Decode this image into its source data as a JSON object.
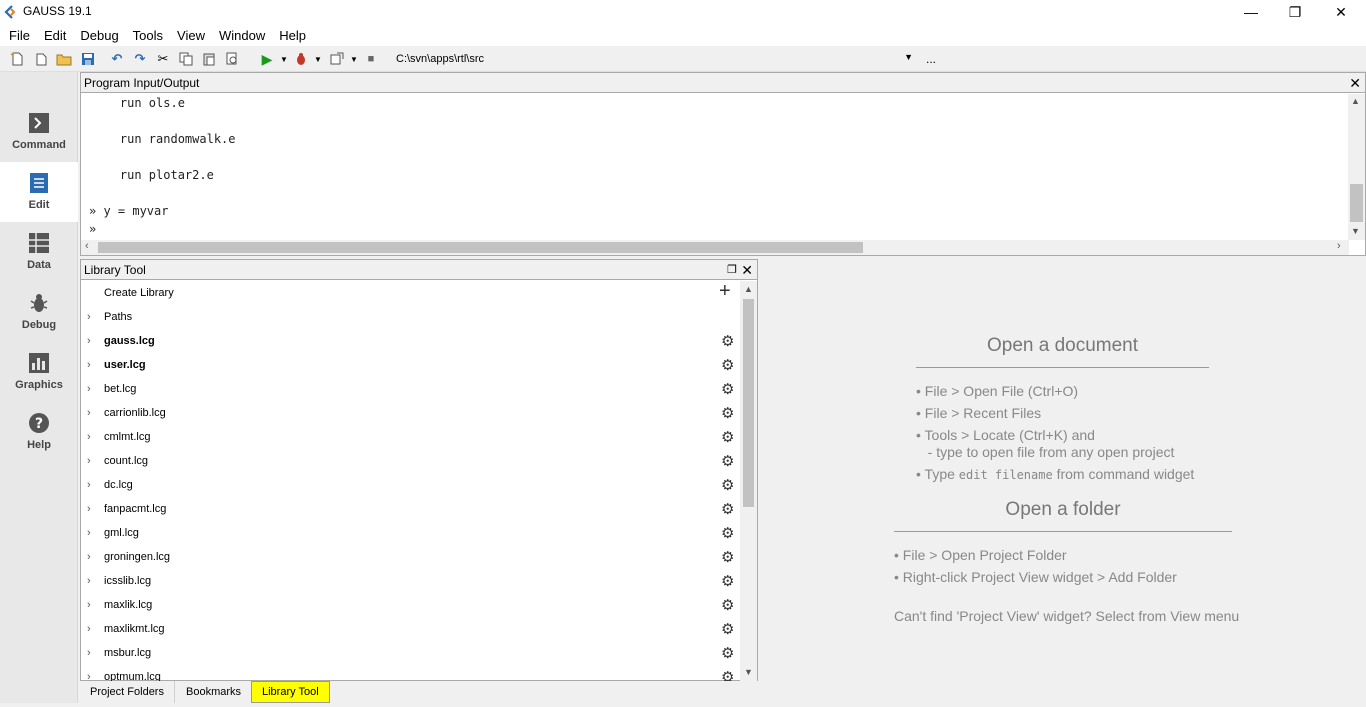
{
  "window": {
    "title": "GAUSS 19.1",
    "minimize": "—",
    "maximize": "❐",
    "close": "✕"
  },
  "menu": [
    "File",
    "Edit",
    "Debug",
    "Tools",
    "View",
    "Window",
    "Help"
  ],
  "toolbar": {
    "path": "C:\\svn\\apps\\rtl\\src",
    "more": "..."
  },
  "sidebar": [
    {
      "label": "Command",
      "icon": "command-icon"
    },
    {
      "label": "Edit",
      "icon": "edit-icon"
    },
    {
      "label": "Data",
      "icon": "data-icon"
    },
    {
      "label": "Debug",
      "icon": "debug-icon"
    },
    {
      "label": "Graphics",
      "icon": "graphics-icon"
    },
    {
      "label": "Help",
      "icon": "help-icon"
    }
  ],
  "pio": {
    "title": "Program Input/Output",
    "lines": [
      "    run ols.e",
      "    run randomwalk.e",
      "    run plotar2.e",
      "» y = myvar",
      "»"
    ]
  },
  "library": {
    "title": "Library Tool",
    "create": "Create Library",
    "paths": "Paths",
    "items": [
      {
        "name": "gauss.lcg",
        "bold": true
      },
      {
        "name": "user.lcg",
        "bold": true
      },
      {
        "name": "bet.lcg",
        "bold": false
      },
      {
        "name": "carrionlib.lcg",
        "bold": false
      },
      {
        "name": "cmlmt.lcg",
        "bold": false
      },
      {
        "name": "count.lcg",
        "bold": false
      },
      {
        "name": "dc.lcg",
        "bold": false
      },
      {
        "name": "fanpacmt.lcg",
        "bold": false
      },
      {
        "name": "gml.lcg",
        "bold": false
      },
      {
        "name": "groningen.lcg",
        "bold": false
      },
      {
        "name": "icsslib.lcg",
        "bold": false
      },
      {
        "name": "maxlik.lcg",
        "bold": false
      },
      {
        "name": "maxlikmt.lcg",
        "bold": false
      },
      {
        "name": "msbur.lcg",
        "bold": false
      },
      {
        "name": "optmum.lcg",
        "bold": false
      }
    ]
  },
  "tabs": [
    "Project Folders",
    "Bookmarks",
    "Library Tool"
  ],
  "welcome": {
    "doc_title": "Open a document",
    "doc_items": [
      "• File > Open File (Ctrl+O)",
      "• File > Recent Files",
      "• Tools > Locate (Ctrl+K) and",
      "   - type to open file from any open project"
    ],
    "doc_type_prefix": "• Type ",
    "doc_type_code": "edit filename",
    "doc_type_suffix": " from command widget",
    "folder_title": "Open a folder",
    "folder_items": [
      "• File > Open Project Folder",
      "• Right-click Project View widget > Add Folder"
    ],
    "hint": "Can't find 'Project View' widget? Select from View menu"
  },
  "colors": {
    "run_green": "#1a9a1a",
    "debug_red": "#c0392b",
    "edit_blue": "#2b6cb0",
    "highlight": "#ffff00"
  }
}
